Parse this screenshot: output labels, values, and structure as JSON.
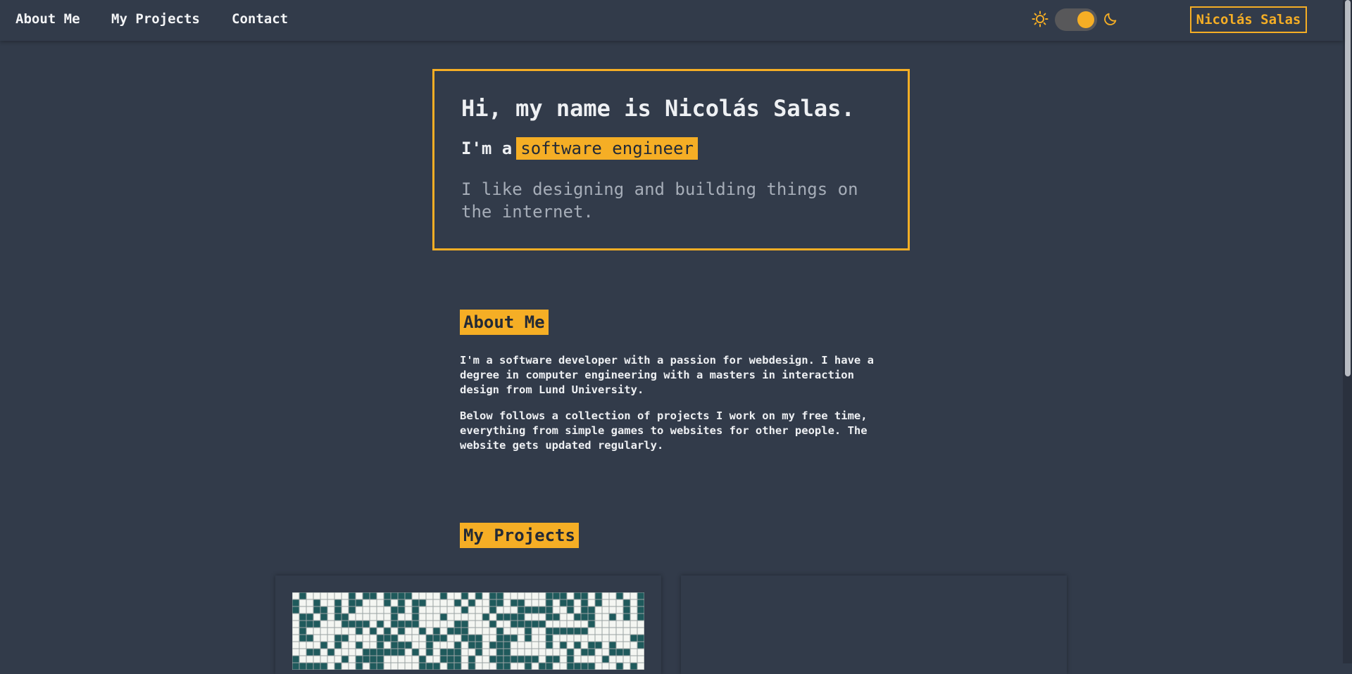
{
  "nav": {
    "links": [
      "About Me",
      "My Projects",
      "Contact"
    ],
    "brand": "Nicolás Salas",
    "theme_toggle": {
      "left_icon": "sun-icon",
      "right_icon": "moon-icon",
      "state": "dark"
    }
  },
  "hero": {
    "title": "Hi, my name is Nicolás Salas.",
    "role_prefix": "I'm a",
    "role": "software engineer",
    "description": "I like designing and building things on the internet."
  },
  "about": {
    "heading": "About Me",
    "paragraphs": [
      "I'm a software developer with a passion for webdesign. I have a degree in computer engineering with a masters in interaction design from Lund University.",
      "Below follows a collection of projects I work on my free time, everything from simple games to websites for other people. The website gets updated regularly."
    ]
  },
  "projects": {
    "heading": "My Projects"
  },
  "colors": {
    "background": "#323b4a",
    "accent": "#f5ae25",
    "text": "#eef0f3",
    "muted_text": "#a6adb8",
    "grid_fill": "#1f5a5c",
    "grid_empty": "#f4f6f2"
  }
}
